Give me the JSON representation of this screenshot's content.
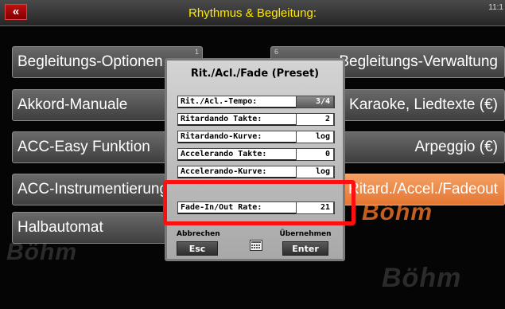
{
  "topbar": {
    "back_glyph": "«",
    "title": "Rhythmus & Begleitung:",
    "clock": "11:1"
  },
  "left_menu": [
    {
      "label": "Begleitungs-Optionen"
    },
    {
      "label": "Akkord-Manuale"
    },
    {
      "label": "ACC-Easy Funktion"
    },
    {
      "label": "ACC-Instrumentierung"
    },
    {
      "label": "Halbautomat"
    }
  ],
  "right_menu": [
    {
      "num": "6",
      "label": "Begleitungs-Verwaltung"
    },
    {
      "label": "Karaoke, Liedtexte (€)"
    },
    {
      "label": "Arpeggio (€)"
    },
    {
      "label": "Ritard./Accel./Fadeout",
      "active": true
    }
  ],
  "left_num": "1",
  "watermark": "Böhm",
  "dialog": {
    "title": "Rit./Acl./Fade (Preset)",
    "rows": [
      {
        "label": "Rit./Acl.-Tempo:",
        "value": "3/4"
      },
      {
        "label": "Ritardando Takte:",
        "value": "2"
      },
      {
        "label": "Ritardando-Kurve:",
        "value": "log"
      },
      {
        "label": "Accelerando Takte:",
        "value": "0"
      },
      {
        "label": "Accelerando-Kurve:",
        "value": "log"
      },
      {
        "label": "Fade-In/Out Rate:",
        "value": "21"
      }
    ],
    "cancel_caption": "Abbrechen",
    "cancel_button": "Esc",
    "ok_caption": "Übernehmen",
    "ok_button": "Enter",
    "keypad_icon": "keypad-icon"
  },
  "colors": {
    "title": "#ffe800",
    "active_tile": "#e57732",
    "highlight": "#ff1010"
  }
}
